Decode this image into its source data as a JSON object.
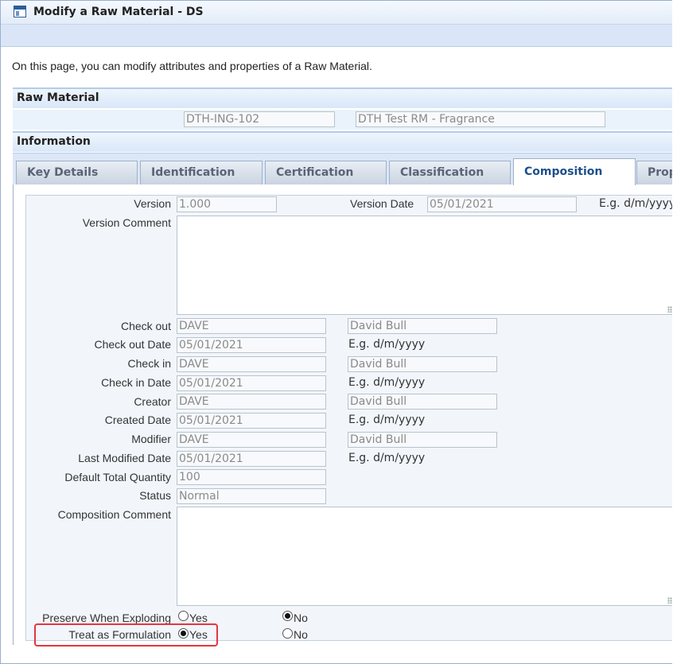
{
  "window": {
    "title": "Modify a Raw Material - DS"
  },
  "description": "On this page, you can modify attributes and properties of a Raw Material.",
  "raw_material": {
    "header": "Raw Material",
    "code": "DTH-ING-102",
    "name": "DTH Test RM - Fragrance"
  },
  "information": {
    "header": "Information"
  },
  "tabs": [
    {
      "label": "Key Details"
    },
    {
      "label": "Identification"
    },
    {
      "label": "Certification"
    },
    {
      "label": "Classification"
    },
    {
      "label": "Composition",
      "active": true
    },
    {
      "label": "Prop"
    }
  ],
  "composition": {
    "version": {
      "label": "Version",
      "value": "1.000"
    },
    "version_date": {
      "label": "Version Date",
      "value": "05/01/2021",
      "hint": "E.g. d/m/yyyy"
    },
    "version_comment": {
      "label": "Version Comment",
      "value": ""
    },
    "check_out": {
      "label": "Check out",
      "user": "DAVE",
      "name": "David Bull"
    },
    "check_out_date": {
      "label": "Check out Date",
      "value": "05/01/2021",
      "hint": "E.g. d/m/yyyy"
    },
    "check_in": {
      "label": "Check in",
      "user": "DAVE",
      "name": "David Bull"
    },
    "check_in_date": {
      "label": "Check in Date",
      "value": "05/01/2021",
      "hint": "E.g. d/m/yyyy"
    },
    "creator": {
      "label": "Creator",
      "user": "DAVE",
      "name": "David Bull"
    },
    "created_date": {
      "label": "Created Date",
      "value": "05/01/2021",
      "hint": "E.g. d/m/yyyy"
    },
    "modifier": {
      "label": "Modifier",
      "user": "DAVE",
      "name": "David Bull"
    },
    "last_modified_date": {
      "label": "Last Modified Date",
      "value": "05/01/2021",
      "hint": "E.g. d/m/yyyy"
    },
    "default_total_quantity": {
      "label": "Default Total Quantity",
      "value": "100"
    },
    "status": {
      "label": "Status",
      "value": "Normal"
    },
    "composition_comment": {
      "label": "Composition Comment",
      "value": ""
    },
    "preserve_when_exploding": {
      "label": "Preserve When Exploding",
      "yes": "Yes",
      "no": "No",
      "selected": "No"
    },
    "treat_as_formulation": {
      "label": "Treat as Formulation",
      "yes": "Yes",
      "no": "No",
      "selected": "Yes"
    }
  },
  "colors": {
    "highlight": "#e2373f",
    "active_tab_text": "#1d4f8c",
    "header_bg": "#dae6f7"
  }
}
